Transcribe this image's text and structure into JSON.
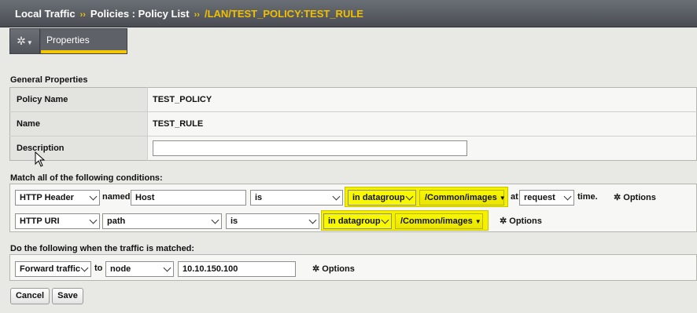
{
  "breadcrumb": {
    "items": [
      "Local Traffic",
      "Policies : Policy List"
    ],
    "current": "/LAN/TEST_POLICY:TEST_RULE",
    "separator": "››"
  },
  "toolbar": {
    "menu_icon": "gear-icon",
    "tab_label": "Properties"
  },
  "general": {
    "title": "General Properties",
    "policy_name_label": "Policy Name",
    "policy_name_value": "TEST_POLICY",
    "name_label": "Name",
    "name_value": "TEST_RULE",
    "description_label": "Description",
    "description_value": ""
  },
  "conditions": {
    "title": "Match all of the following conditions:",
    "row1": {
      "type": "HTTP Header",
      "named_label": "named",
      "named_value": "Host",
      "operator": "is",
      "match": "in datagroup",
      "datagroup": "/Common/images",
      "at_label": "at",
      "event": "request",
      "time_label": "time.",
      "options_label": "Options"
    },
    "row2": {
      "type": "HTTP URI",
      "part": "path",
      "operator": "is",
      "match": "in datagroup",
      "datagroup": "/Common/images",
      "options_label": "Options"
    }
  },
  "actions": {
    "title": "Do the following when the traffic is matched:",
    "action": "Forward traffic",
    "to_label": "to",
    "target": "node",
    "address": "10.10.150.100",
    "options_label": "Options"
  },
  "buttons": {
    "cancel": "Cancel",
    "save": "Save"
  },
  "colors": {
    "highlight": "#f5ef00",
    "accent": "#f3c600",
    "header": "#55595f"
  }
}
